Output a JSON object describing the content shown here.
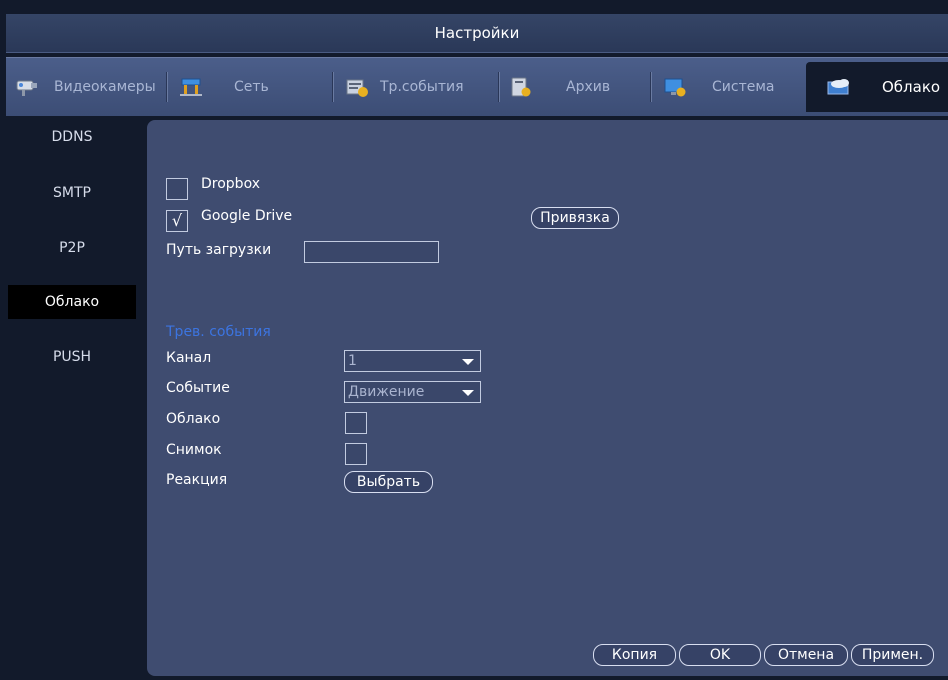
{
  "window": {
    "title": "Настройки"
  },
  "tabs": [
    {
      "label": "Видеокамеры",
      "icon": "camera-icon"
    },
    {
      "label": "Сеть",
      "icon": "network-icon"
    },
    {
      "label": "Тр.события",
      "icon": "alarm-events-icon"
    },
    {
      "label": "Архив",
      "icon": "storage-icon"
    },
    {
      "label": "Система",
      "icon": "system-icon"
    },
    {
      "label": "Облако",
      "icon": "cloud-icon",
      "active": true
    }
  ],
  "sidebar": {
    "items": [
      {
        "label": "DDNS"
      },
      {
        "label": "SMTP"
      },
      {
        "label": "P2P"
      },
      {
        "label": "Облако",
        "active": true
      },
      {
        "label": "PUSH"
      }
    ]
  },
  "cloud": {
    "dropbox": {
      "label": "Dropbox",
      "checked": false
    },
    "google_drive": {
      "label": "Google Drive",
      "checked": true,
      "check_mark": "√"
    },
    "bind_button": "Привязка",
    "upload_path": {
      "label": "Путь загрузки",
      "value": ""
    }
  },
  "alarm": {
    "section_title": "Трев. события",
    "channel": {
      "label": "Канал",
      "value": "1"
    },
    "event": {
      "label": "Событие",
      "value": "Движение"
    },
    "cloud": {
      "label": "Облако",
      "checked": false
    },
    "snapshot": {
      "label": "Снимок",
      "checked": false
    },
    "reaction": {
      "label": "Реакция",
      "button": "Выбрать"
    }
  },
  "footer": {
    "copy": "Копия",
    "ok": "OK",
    "cancel": "Отмена",
    "apply": "Примен."
  },
  "colors": {
    "background": "#121a2b",
    "panel": "#3f4c70",
    "accent": "#3c74e0"
  }
}
